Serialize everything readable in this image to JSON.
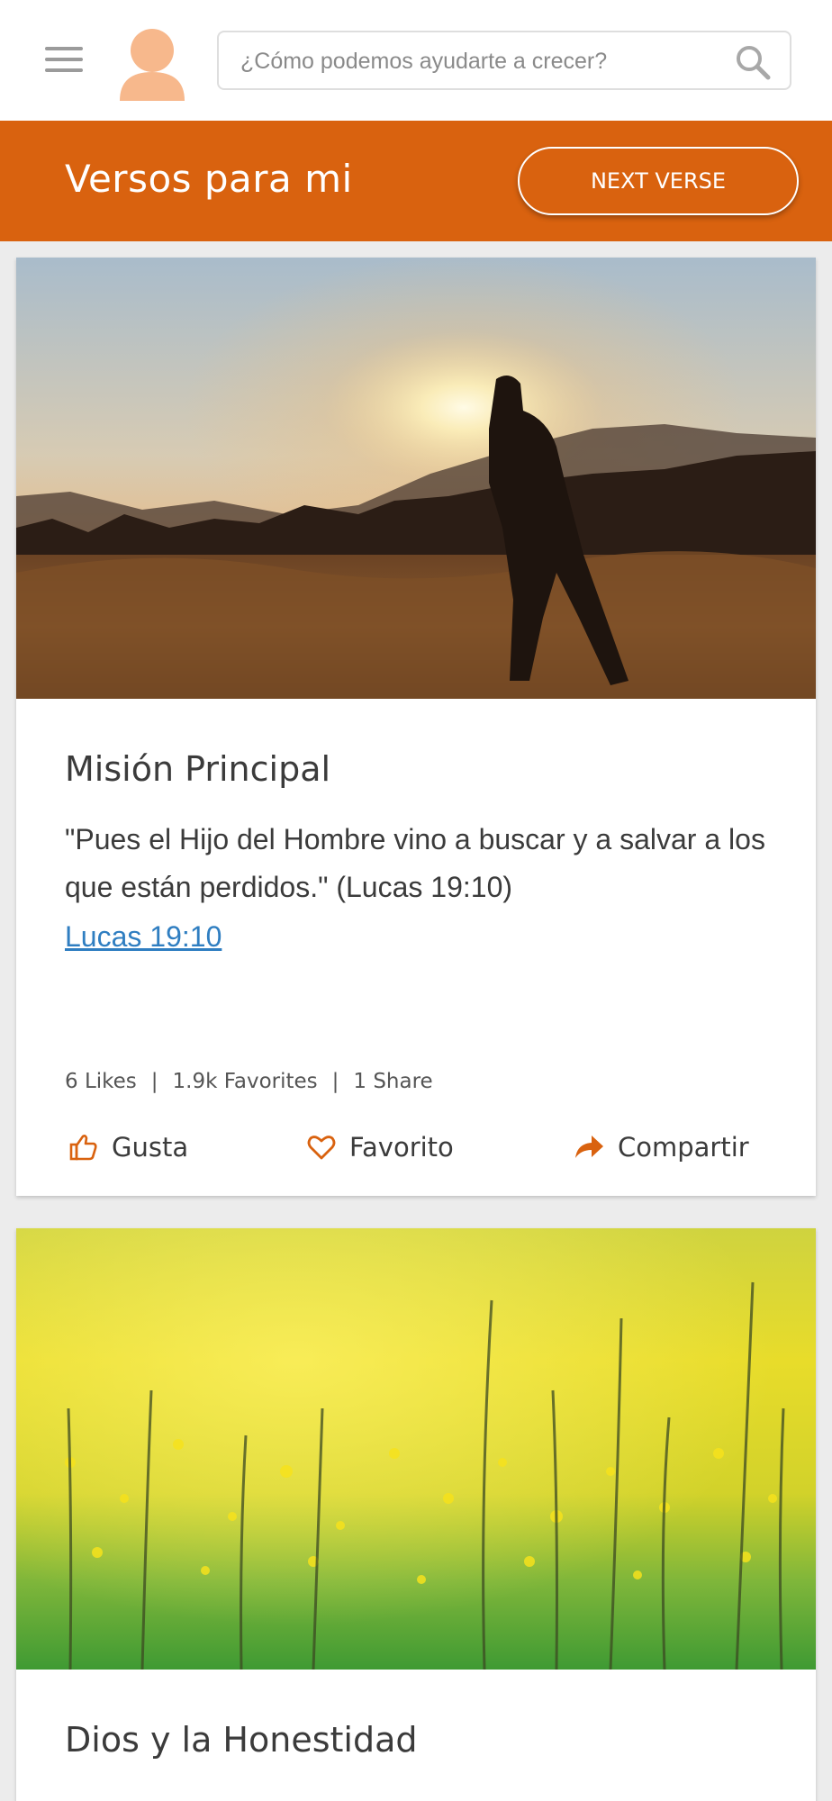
{
  "header": {
    "search_placeholder": "¿Cómo podemos ayudarte a crecer?"
  },
  "banner": {
    "title": "Versos para mi",
    "next_label": "NEXT VERSE"
  },
  "cards": [
    {
      "title": "Misión Principal",
      "text": "\"Pues el Hijo del Hombre vino a buscar y a salvar a los que están perdidos.\" (Lucas 19:10)",
      "link": "Lucas 19:10",
      "likes": "6 Likes",
      "favorites": "1.9k Favorites",
      "shares": "1 Share",
      "separator": "|",
      "actions": {
        "like": "Gusta",
        "favorite": "Favorito",
        "share": "Compartir"
      }
    },
    {
      "title": "Dios y la Honestidad"
    }
  ],
  "colors": {
    "accent": "#d9620f",
    "link": "#2f7ec1",
    "avatar": "#f7b88c"
  },
  "icons": [
    "menu-icon",
    "avatar-icon",
    "search-icon",
    "thumbs-up-icon",
    "heart-icon",
    "share-arrow-icon"
  ]
}
